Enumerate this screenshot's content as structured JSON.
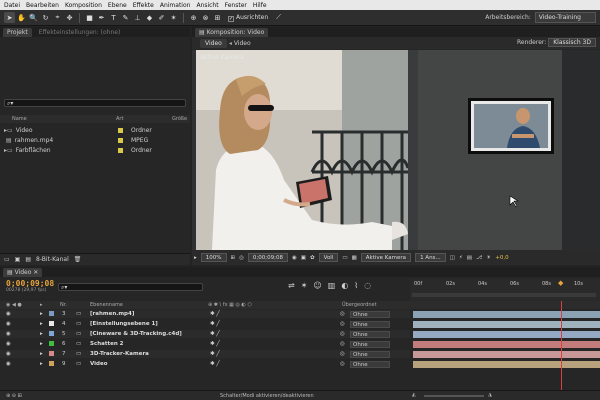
{
  "menu": [
    "Datei",
    "Bearbeiten",
    "Komposition",
    "Ebene",
    "Effekte",
    "Animation",
    "Ansicht",
    "Fenster",
    "Hilfe"
  ],
  "toolbar": {
    "align_label": "Ausrichten",
    "workspace_label": "Arbeitsbereich:",
    "workspace_value": "Video-Training"
  },
  "project_panel": {
    "tab_project": "Projekt",
    "tab_effects": "Effekteinstellungen: (ohne)",
    "columns": {
      "name": "Name",
      "type": "Art",
      "size": "Größe"
    },
    "items": [
      {
        "name": "Video",
        "type": "Ordner",
        "color": "#d9c84a"
      },
      {
        "name": "rahmen.mp4",
        "type": "MPEG",
        "color": "#d9c84a"
      },
      {
        "name": "Farbflächen",
        "type": "Ordner",
        "color": "#d9c84a"
      }
    ],
    "bit_depth": "8-Bit-Kanal"
  },
  "composition_panel": {
    "tab_label": "Komposition: Video",
    "sub_tabs": [
      "Video",
      "Video"
    ],
    "renderer_label": "Renderer:",
    "renderer_value": "Klassisch 3D",
    "camera_overlay": "Aktive Kamera",
    "zoom": "100%",
    "timecode": "0;00;09;08",
    "resolution": "Voll",
    "view": "Aktive Kamera",
    "views_count": "1 Ans...",
    "exposure": "+0,0"
  },
  "timeline": {
    "tab_label": "Video",
    "timecode": "0;00;09;08",
    "frame_info": "00278 (29,97 fps)",
    "columns": {
      "num": "Nr.",
      "name": "Ebenenname",
      "parent": "Übergeordnet"
    },
    "ruler": [
      "00f",
      "02s",
      "04s",
      "06s",
      "08s",
      "10s"
    ],
    "layers": [
      {
        "num": "3",
        "name": "[rahmen.mp4]",
        "color": "#7a9cc2",
        "parent": "Ohne",
        "bar": "#8aa2b4"
      },
      {
        "num": "4",
        "name": "[Einstellungsebene 1]",
        "color": "#e8e8e8",
        "parent": "Ohne",
        "bar": "#9fb1bd"
      },
      {
        "num": "5",
        "name": "[Cineware & 3D-Tracking.c4d]",
        "color": "#7fa7d4",
        "parent": "Ohne",
        "bar": "#95a9c4"
      },
      {
        "num": "6",
        "name": "Schatten 2",
        "color": "#3fbf3f",
        "parent": "Ohne",
        "bar": "#c27c7c"
      },
      {
        "num": "7",
        "name": "3D-Tracker-Kamera",
        "color": "#d88a8a",
        "parent": "Ohne",
        "bar": "#c89898"
      },
      {
        "num": "9",
        "name": "Video",
        "color": "#cfa45a",
        "parent": "Ohne",
        "bar": "#b8a27e"
      }
    ],
    "footer": "Schalter/Modi aktivieren/deaktivieren"
  }
}
